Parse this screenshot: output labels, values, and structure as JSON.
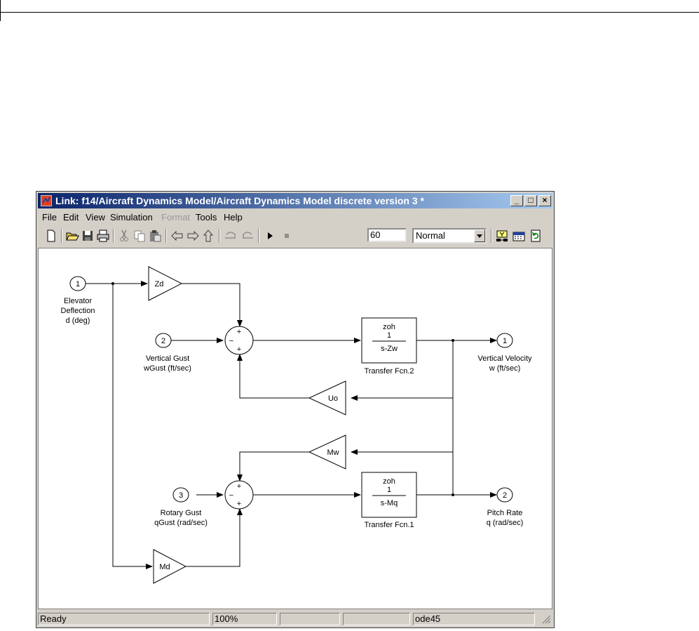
{
  "window": {
    "title": "Link: f14/Aircraft Dynamics Model/Aircraft Dynamics Model discrete version 3 *",
    "controls": [
      "_",
      "□",
      "×"
    ]
  },
  "menu": [
    {
      "label": "File",
      "enabled": true
    },
    {
      "label": "Edit",
      "enabled": true
    },
    {
      "label": "View",
      "enabled": true
    },
    {
      "label": "Simulation",
      "enabled": true
    },
    {
      "label": "Format",
      "enabled": false
    },
    {
      "label": "Tools",
      "enabled": true
    },
    {
      "label": "Help",
      "enabled": true
    }
  ],
  "toolbar": {
    "stop_time": "60",
    "sim_mode": "Normal",
    "icons": [
      "new-icon",
      "open-icon",
      "save-icon",
      "print-icon",
      "cut-icon",
      "copy-icon",
      "paste-icon",
      "back-icon",
      "forward-icon",
      "up-icon",
      "undo-icon",
      "redo-icon",
      "play-icon",
      "stop-icon",
      "build-icon",
      "library-icon",
      "refresh-icon"
    ]
  },
  "diagram": {
    "inports": [
      {
        "num": "1",
        "label1": "Elevator",
        "label2": "Deflection",
        "label3": "d (deg)"
      },
      {
        "num": "2",
        "label1": "Vertical Gust",
        "label2": "wGust (ft/sec)"
      },
      {
        "num": "3",
        "label1": "Rotary Gust",
        "label2": "qGust (rad/sec)"
      }
    ],
    "outports": [
      {
        "num": "1",
        "label1": "Vertical Velocity",
        "label2": "w (ft/sec)"
      },
      {
        "num": "2",
        "label1": "Pitch Rate",
        "label2": "q (rad/sec)"
      }
    ],
    "gains": [
      "Zd",
      "Uo",
      "Mw",
      "Md"
    ],
    "transfer_fcns": [
      {
        "top": "zoh",
        "num": "1",
        "den": "s-Zw",
        "name": "Transfer Fcn.2"
      },
      {
        "top": "zoh",
        "num": "1",
        "den": "s-Mq",
        "name": "Transfer Fcn.1"
      }
    ],
    "sum_signs": [
      "+",
      "−",
      "+"
    ]
  },
  "status": {
    "state": "Ready",
    "zoom": "100%",
    "field3": "",
    "field4": "",
    "solver": "ode45"
  }
}
